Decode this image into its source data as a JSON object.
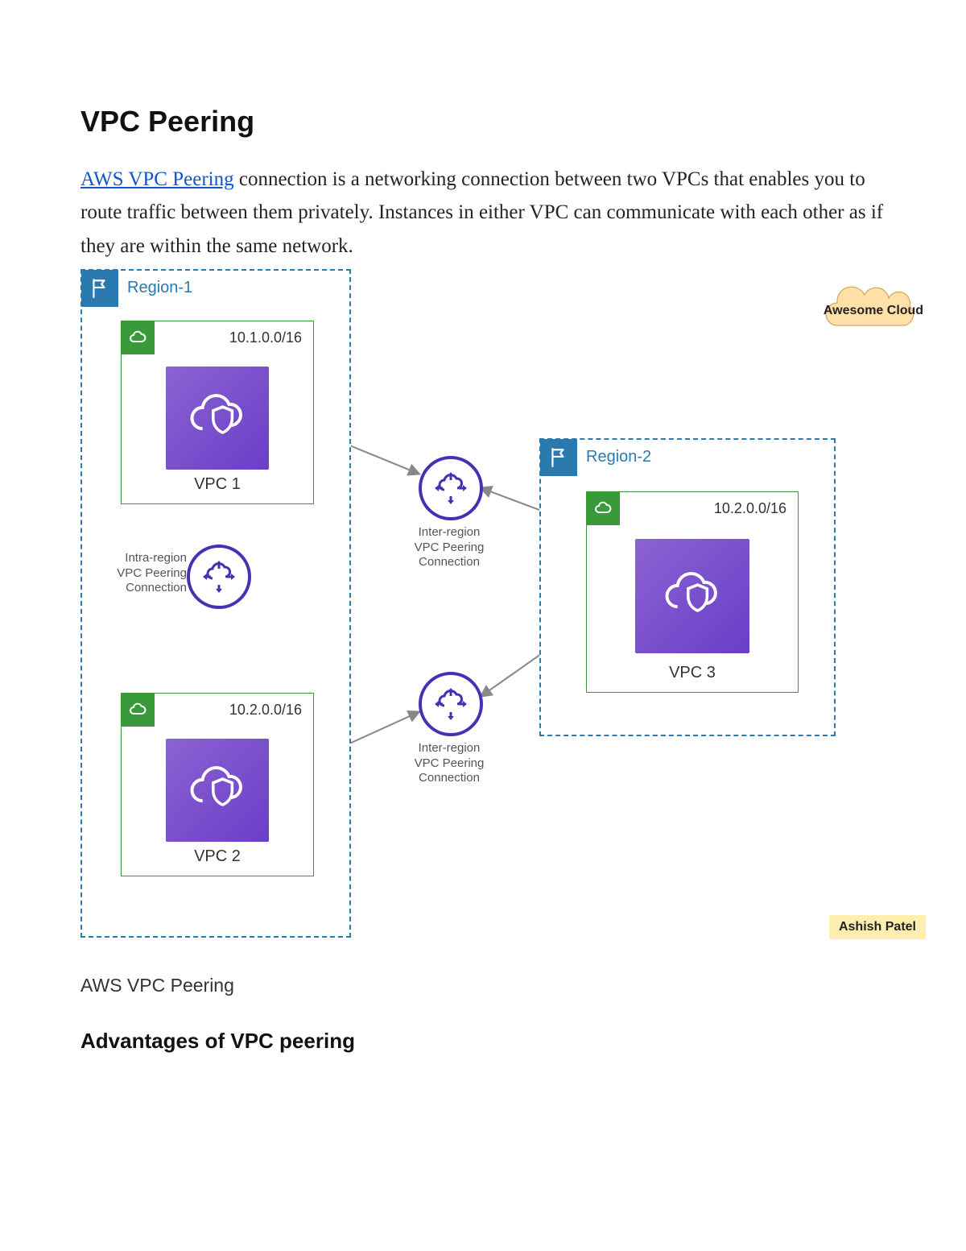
{
  "title": "VPC Peering",
  "intro": {
    "link_text": "AWS VPC Peering",
    "rest": " connection is a networking connection between two VPCs that enables you to route traffic between them privately. Instances in either VPC can communicate with each other as if they are within the same network."
  },
  "figure_caption": "AWS VPC Peering",
  "subheading": "Advantages of VPC peering",
  "diagram": {
    "regions": [
      {
        "id": "region-1",
        "label": "Region-1"
      },
      {
        "id": "region-2",
        "label": "Region-2"
      }
    ],
    "vpcs": [
      {
        "id": "vpc-1",
        "name": "VPC 1",
        "cidr": "10.1.0.0/16"
      },
      {
        "id": "vpc-2",
        "name": "VPC 2",
        "cidr": "10.2.0.0/16"
      },
      {
        "id": "vpc-3",
        "name": "VPC 3",
        "cidr": "10.2.0.0/16"
      }
    ],
    "labels": {
      "intra": "Intra-region\nVPC Peering\nConnection",
      "inter_top": "Inter-region\nVPC Peering\nConnection",
      "inter_bottom": "Inter-region\nVPC Peering\nConnection"
    },
    "annotations": {
      "brand": "Awesome\nCloud",
      "author": "Ashish Patel"
    }
  }
}
